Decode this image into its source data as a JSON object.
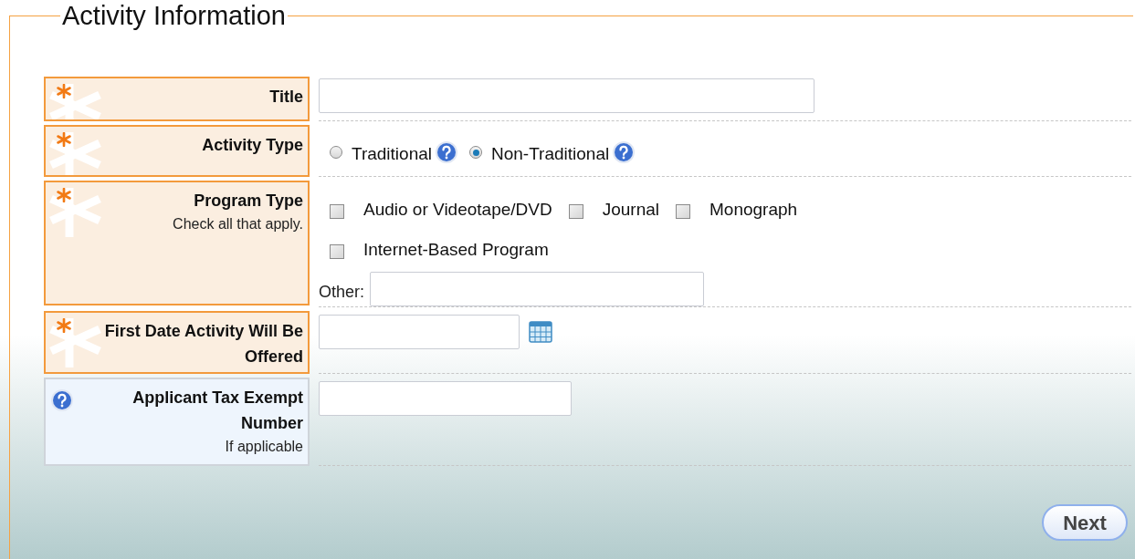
{
  "legend": "Activity Information",
  "rows": [
    {
      "label": "Title",
      "required": true,
      "field": {
        "kind": "text"
      }
    },
    {
      "label": "Activity Type",
      "required": true,
      "field": {
        "kind": "radio",
        "options": [
          {
            "label": "Traditional",
            "selected": false
          },
          {
            "label": "Non-Traditional",
            "selected": true
          }
        ]
      }
    },
    {
      "label": "Program Type",
      "note": "Check all that apply.",
      "required": true,
      "field": {
        "kind": "checkboxes",
        "options": [
          {
            "label": "Audio or Videotape/DVD",
            "checked": false
          },
          {
            "label": "Journal",
            "checked": false
          },
          {
            "label": "Monograph",
            "checked": false
          },
          {
            "label": "Internet-Based Program",
            "checked": false
          }
        ],
        "other_label": "Other:"
      }
    },
    {
      "label": "First Date Activity Will Be Offered",
      "required": true,
      "field": {
        "kind": "date"
      }
    },
    {
      "label": "Applicant Tax Exempt Number",
      "note": "If applicable",
      "required": false,
      "field": {
        "kind": "short_text"
      }
    }
  ],
  "next_button": "Next"
}
